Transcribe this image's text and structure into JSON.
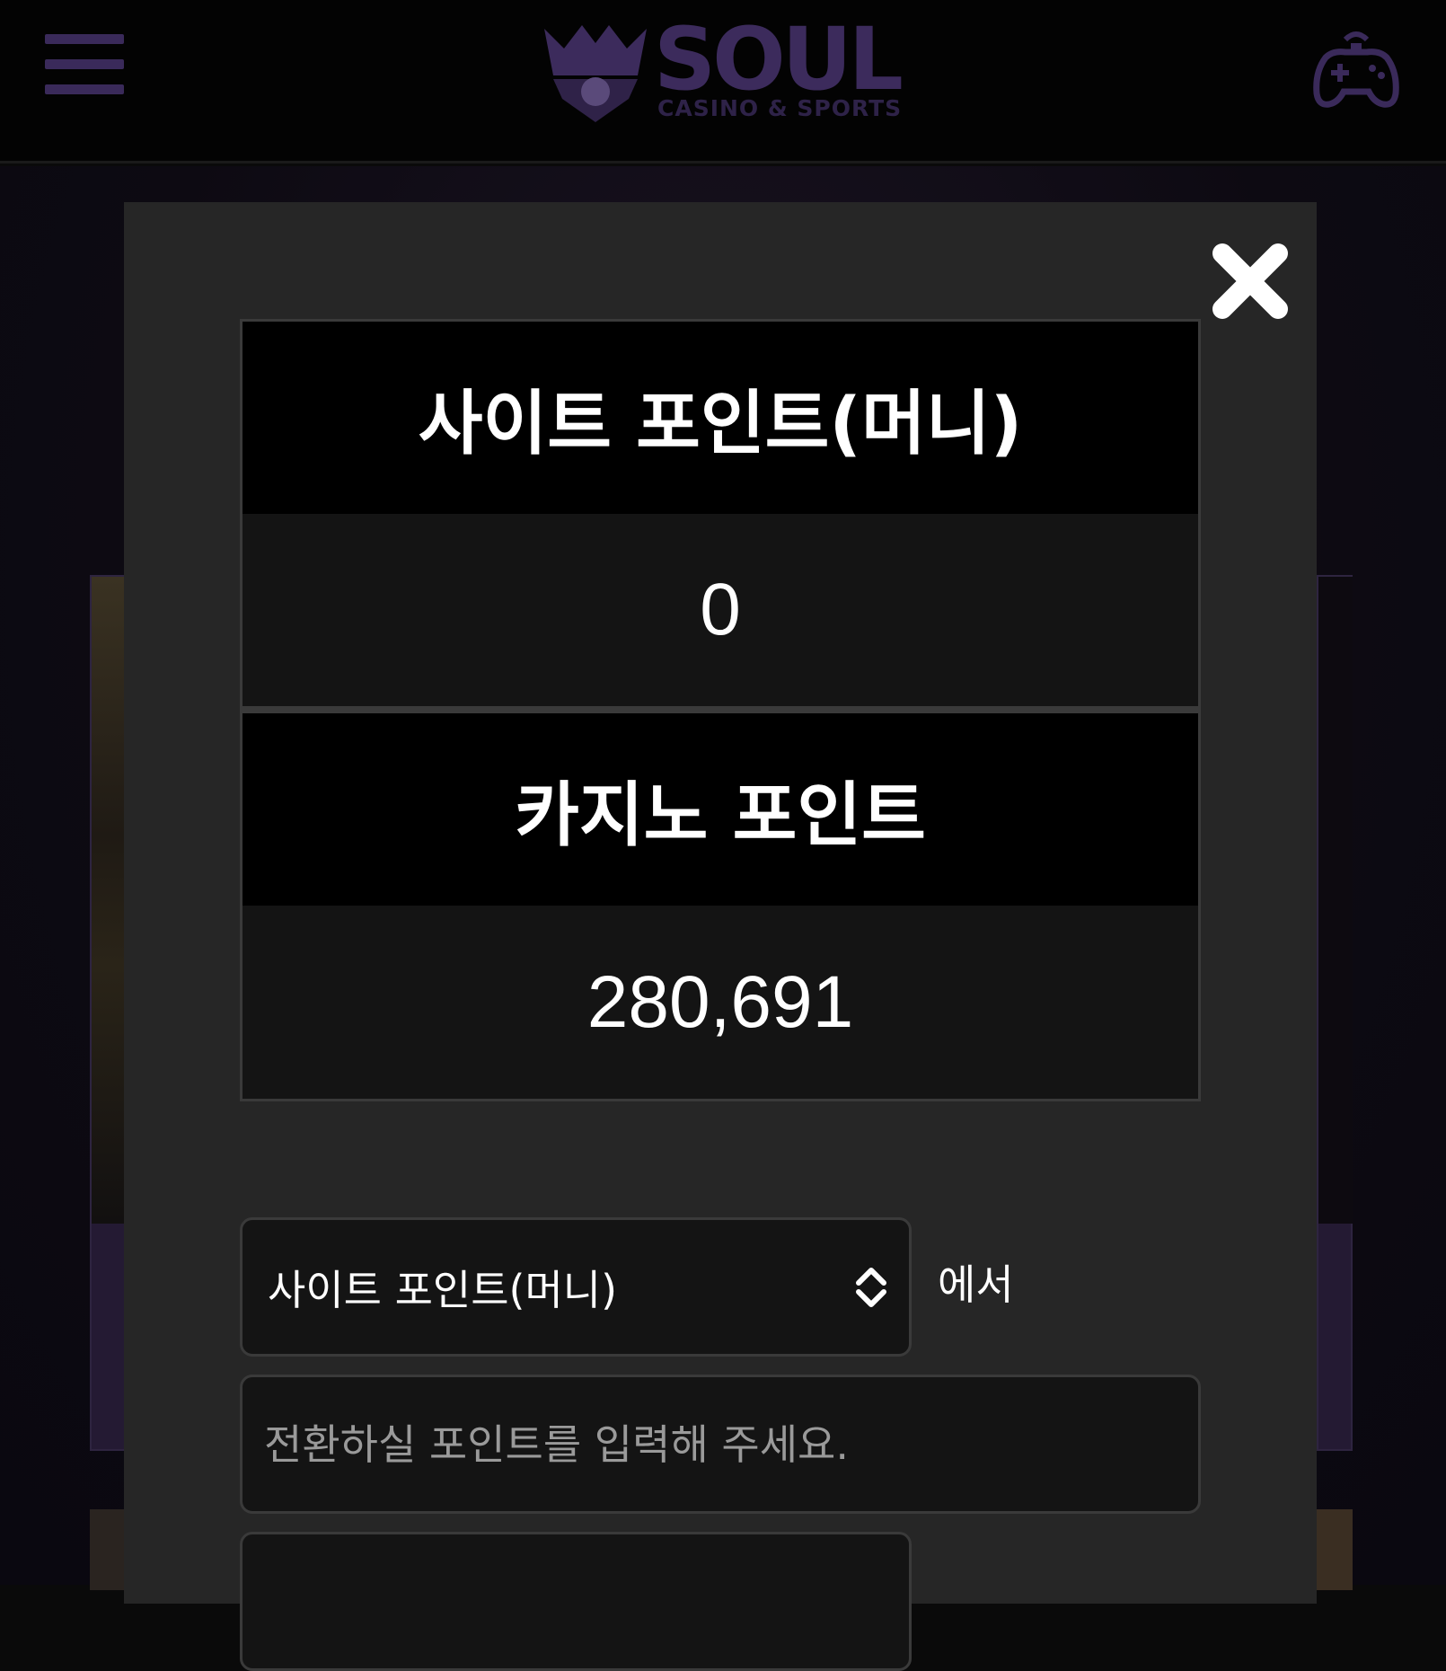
{
  "header": {
    "logo_title": "SOUL",
    "logo_subtitle": "CASINO & SPORTS",
    "menu_icon": "hamburger-menu-icon",
    "game_icon": "gamepad-icon"
  },
  "modal": {
    "close_icon": "close-icon",
    "site_points": {
      "label": "사이트 포인트(머니)",
      "value": "0"
    },
    "casino_points": {
      "label": "카지노 포인트",
      "value": "280,691"
    },
    "convert": {
      "source_select_value": "사이트 포인트(머니)",
      "from_label": "에서",
      "amount_placeholder": "전환하실 포인트를 입력해 주세요."
    }
  },
  "colors": {
    "brand_purple": "#3c2b5c",
    "modal_bg": "#262626",
    "header_bg": "#030303"
  }
}
